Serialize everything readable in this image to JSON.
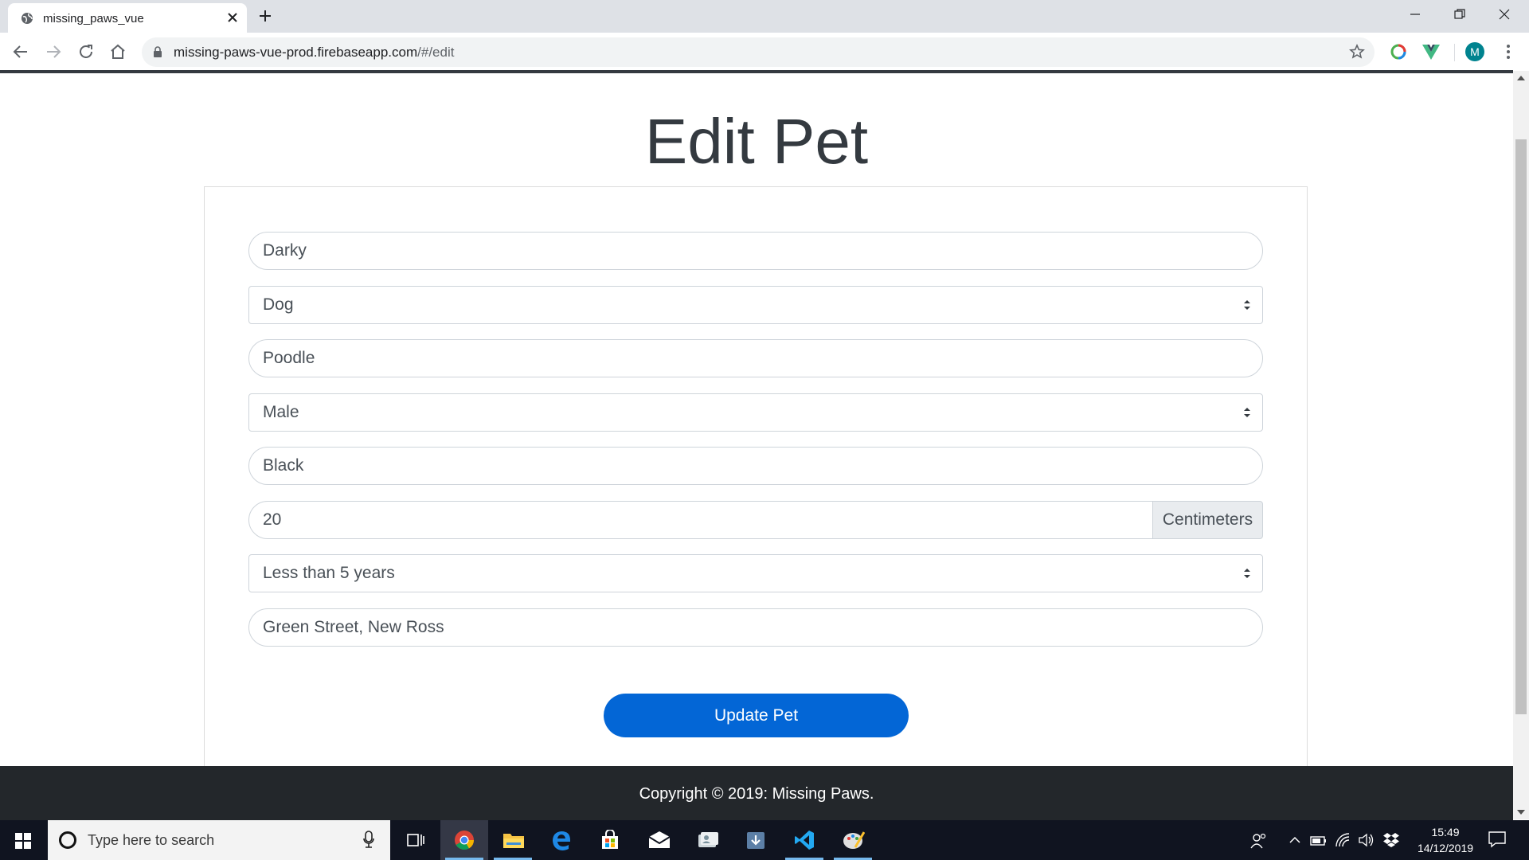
{
  "browser": {
    "tab_title": "missing_paws_vue",
    "url_host": "missing-paws-vue-prod.firebaseapp.com",
    "url_path": "/#/edit",
    "profile_initial": "M"
  },
  "page": {
    "title": "Edit Pet",
    "form": {
      "name": "Darky",
      "type": "Dog",
      "breed": "Poodle",
      "gender": "Male",
      "color": "Black",
      "size": "20",
      "size_unit": "Centimeters",
      "age": "Less than 5 years",
      "location": "Green Street, New Ross"
    },
    "submit_label": "Update Pet"
  },
  "footer": {
    "copyright": "Copyright © 2019: Missing Paws."
  },
  "taskbar": {
    "search_placeholder": "Type here to search",
    "time": "15:49",
    "date": "14/12/2019"
  },
  "colors": {
    "primary_button": "#0366d6",
    "footer_bg": "#23272b",
    "taskbar_bg": "#101420"
  }
}
